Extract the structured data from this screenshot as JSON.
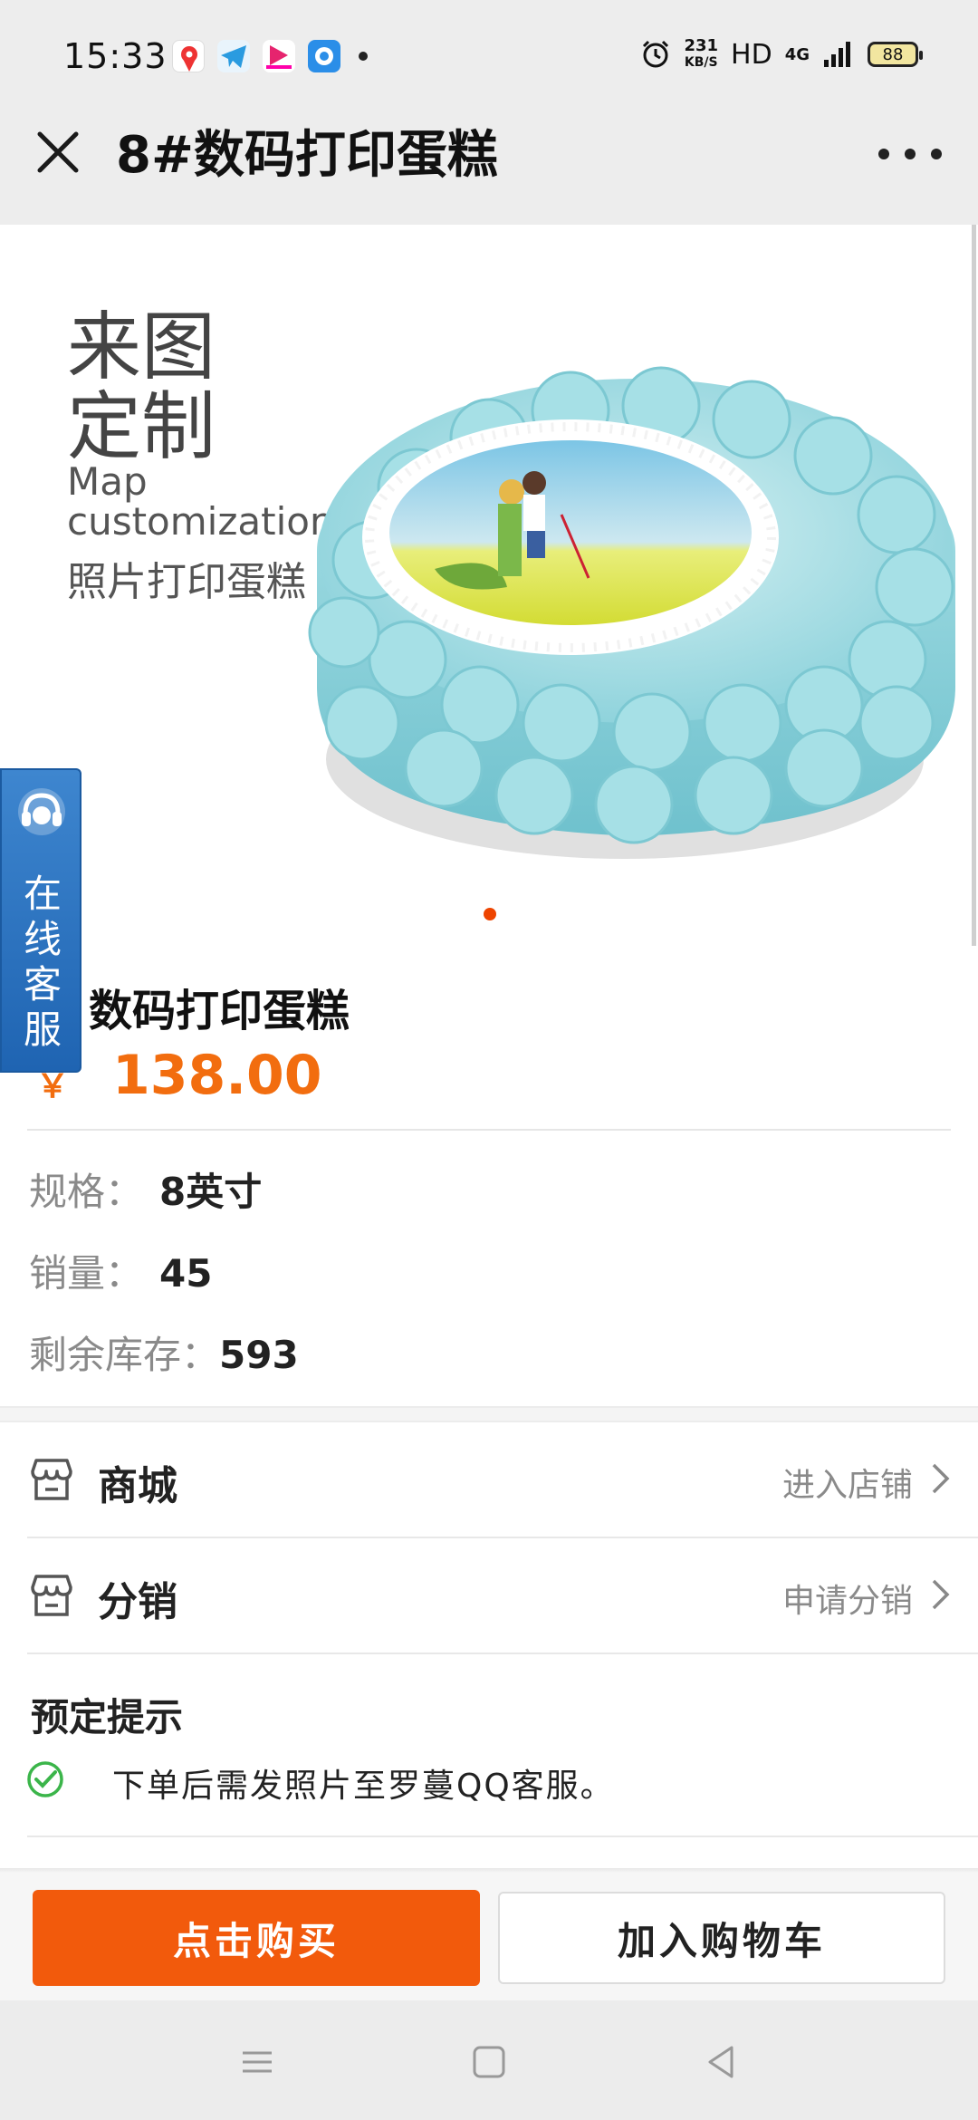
{
  "status_bar": {
    "time": "15:33",
    "net_speed_value": "231",
    "net_speed_unit": "KB/S",
    "hd": "HD",
    "network": "4G",
    "battery": "88"
  },
  "title_bar": {
    "title": "8#数码打印蛋糕"
  },
  "hero": {
    "title_line1": "来图",
    "title_line2": "定制",
    "sub_en_line1": "Map",
    "sub_en_line2": "customization",
    "sub_cn": "照片打印蛋糕",
    "current_slide": 1,
    "slide_count": 1
  },
  "customer_service": {
    "label": "在线客服"
  },
  "product": {
    "name": "数码打印蛋糕",
    "currency": "￥",
    "price": "138.00",
    "specs": [
      {
        "label": "规格：",
        "value": "8英寸"
      },
      {
        "label": "销量：",
        "value": "45"
      },
      {
        "label": "剩余库存：",
        "value": "593"
      }
    ]
  },
  "links": [
    {
      "label": "商城",
      "action": "进入店铺"
    },
    {
      "label": "分销",
      "action": "申请分销"
    }
  ],
  "notice": {
    "title": "预定提示",
    "text": "下单后需发照片至罗蔓QQ客服。"
  },
  "actions": {
    "buy": "点击购买",
    "cart": "加入购物车"
  },
  "colors": {
    "accent": "#f25a0c",
    "price": "#f26d0f",
    "service": "#2a72c0",
    "check": "#3bb54a"
  },
  "icons": {
    "close": "close-icon",
    "more": "more-icon",
    "store": "store-icon",
    "chevron": "chevron-right-icon",
    "check": "check-circle-icon",
    "headset": "headset-icon"
  }
}
